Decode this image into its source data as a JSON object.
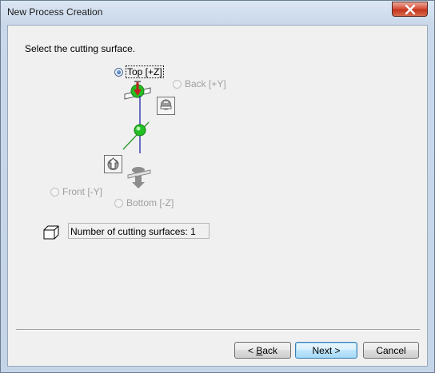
{
  "window": {
    "title": "New Process Creation",
    "close_icon": "close-icon"
  },
  "prompt": "Select the cutting surface.",
  "surfaces": {
    "top": {
      "label": "Top [+Z]",
      "checked": true,
      "enabled": true
    },
    "back": {
      "label": "Back [+Y]",
      "checked": false,
      "enabled": false
    },
    "front": {
      "label": "Front [-Y]",
      "checked": false,
      "enabled": false
    },
    "bottom": {
      "label": "Bottom [-Z]",
      "checked": false,
      "enabled": false
    }
  },
  "info": {
    "icon": "cube-icon",
    "text": "Number of cutting surfaces: 1"
  },
  "buttons": {
    "back": {
      "prefix": "< ",
      "mnemonic": "B",
      "rest": "ack"
    },
    "next": {
      "label": "Next >"
    },
    "cancel": {
      "label": "Cancel"
    }
  },
  "colors": {
    "title_bar": "#c9d8ea",
    "close_button": "#c2351d",
    "sphere": "#22c022",
    "x_axis": "#2a9a2a",
    "z_axis": "#1f2aa8",
    "arrow": "#c02020",
    "default_button_border": "#3c7fb1"
  }
}
